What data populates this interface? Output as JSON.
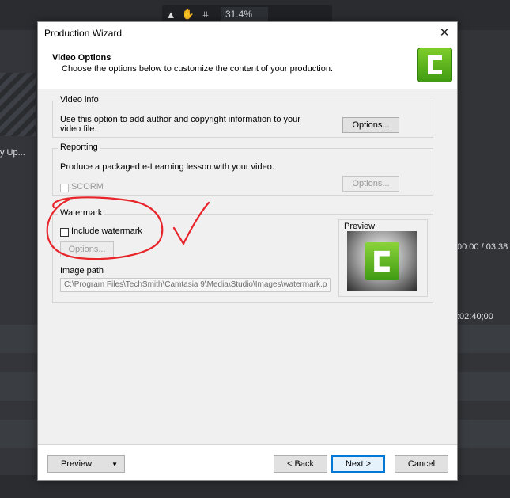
{
  "background": {
    "zoom_level": "31.4%",
    "left_clip_label": "y Up...",
    "time_readout": "00:00 / 03:38",
    "timeline_marker": ":02:40;00"
  },
  "dialog": {
    "title": "Production Wizard",
    "header": {
      "title": "Video Options",
      "description": "Choose the options below to customize the content of your production."
    },
    "video_info": {
      "legend": "Video info",
      "text_line1": "Use this option to add author and copyright information to your",
      "text_line2": "video file.",
      "options_button": "Options..."
    },
    "reporting": {
      "legend": "Reporting",
      "text": "Produce a packaged e-Learning lesson with your video.",
      "scorm_label": "SCORM",
      "scorm_checked": false,
      "options_button": "Options..."
    },
    "watermark": {
      "legend": "Watermark",
      "include_label": "Include watermark",
      "include_checked": false,
      "options_button": "Options...",
      "image_path_label": "Image path",
      "image_path_value": "C:\\Program Files\\TechSmith\\Camtasia 9\\Media\\Studio\\Images\\watermark.p",
      "preview_label": "Preview"
    },
    "footer": {
      "preview_button": "Preview",
      "back_button": "< Back",
      "next_button": "Next >",
      "cancel_button": "Cancel"
    }
  },
  "colors": {
    "accent_focus": "#0078d7",
    "logo_green": "#5cb81d",
    "annotation_red": "#e8252b"
  }
}
